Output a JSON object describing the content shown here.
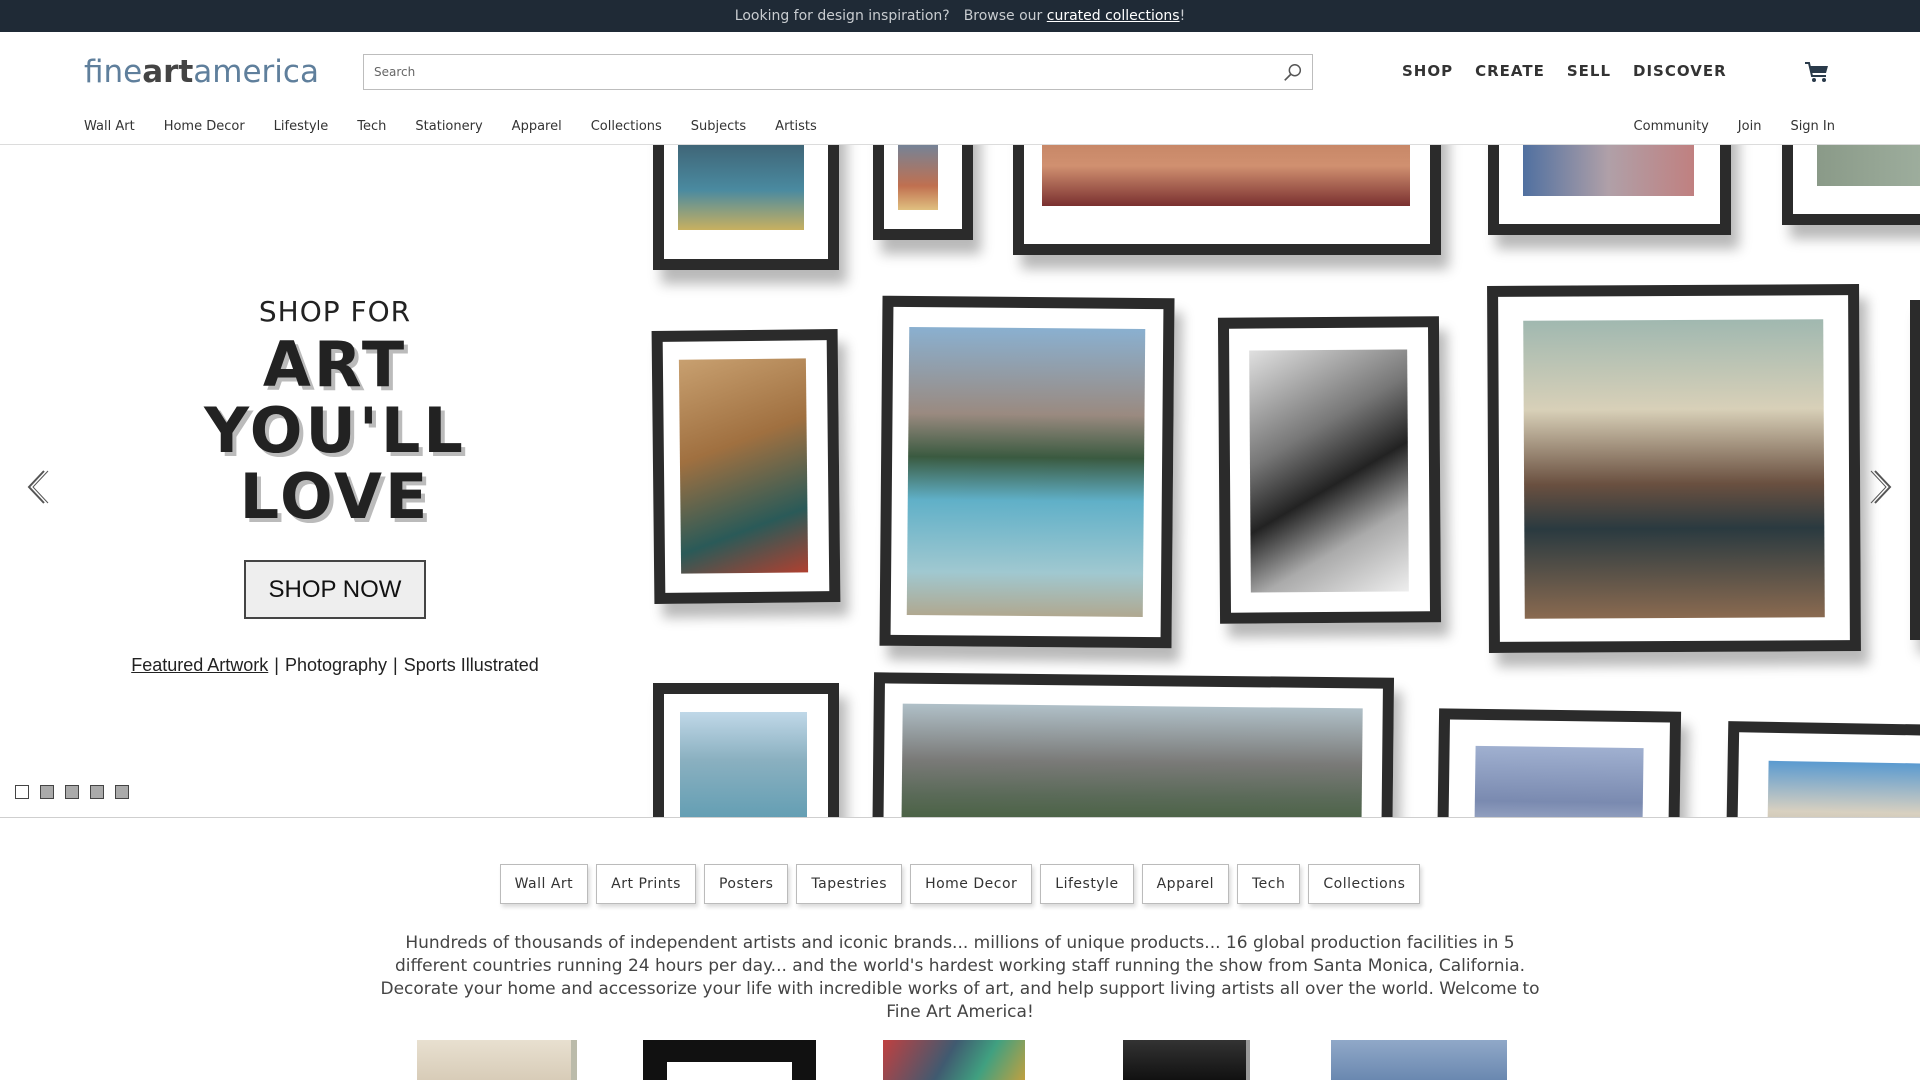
{
  "promo": {
    "text": "Looking for design inspiration?",
    "browse": "Browse our",
    "link": "curated collections",
    "suffix": "!"
  },
  "header": {
    "logo": {
      "part1": "fine",
      "part2": "art",
      "part3": "america"
    },
    "search_placeholder": "Search",
    "main_nav": [
      "SHOP",
      "CREATE",
      "SELL",
      "DISCOVER"
    ],
    "sub_nav": [
      "Wall Art",
      "Home Decor",
      "Lifestyle",
      "Tech",
      "Stationery",
      "Apparel",
      "Collections",
      "Subjects",
      "Artists"
    ],
    "sub_nav_right": [
      "Community",
      "Join",
      "Sign In"
    ]
  },
  "hero": {
    "kicker": "SHOP FOR",
    "headline_line1": "ART YOU'LL",
    "headline_line2": "LOVE",
    "cta": "SHOP NOW",
    "links": [
      "Featured Artwork",
      "Photography",
      "Sports Illustrated"
    ],
    "slides": 5,
    "active_slide": 1
  },
  "categories": [
    "Wall Art",
    "Art Prints",
    "Posters",
    "Tapestries",
    "Home Decor",
    "Lifestyle",
    "Apparel",
    "Tech",
    "Collections"
  ],
  "blurb": "Hundreds of thousands of independent artists and iconic brands... millions of unique products... 16 global production facilities in 5 different countries running 24 hours per day... and the world's hardest working staff running the show from Santa Monica, California.   Decorate your home and accessorize your life with incredible works of art, and help support living artists all over the world.   Welcome to Fine Art America!",
  "colors": {
    "promo_bg": "#1f2a36",
    "logo_blue": "#5f7f9c",
    "frame": "#2b2b2b"
  }
}
